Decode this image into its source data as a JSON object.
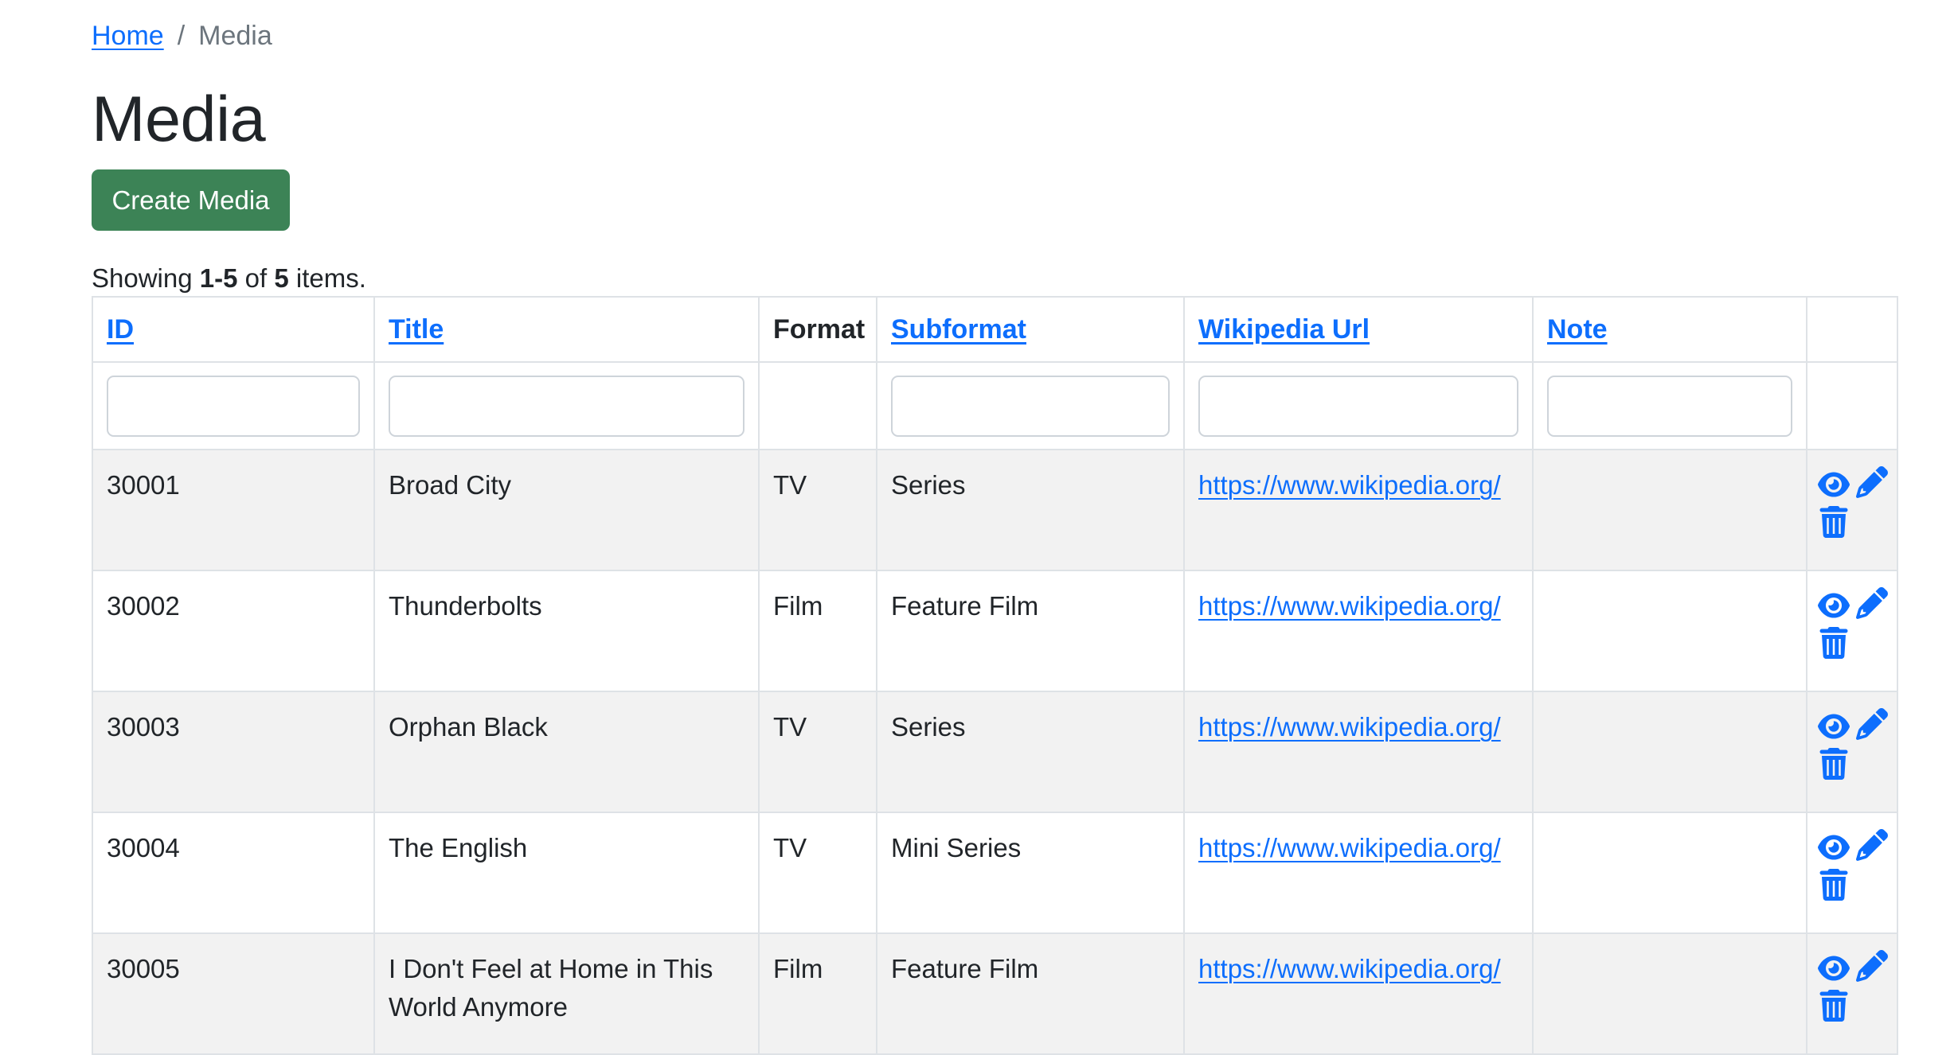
{
  "breadcrumb": {
    "home_label": "Home",
    "separator": "/",
    "current": "Media"
  },
  "page": {
    "title": "Media",
    "create_button_label": "Create Media"
  },
  "summary": {
    "prefix": "Showing",
    "range": "1-5",
    "middle": "of",
    "total": "5",
    "suffix": "items."
  },
  "table": {
    "headers": {
      "id": "ID",
      "title": "Title",
      "format": "Format",
      "subformat": "Subformat",
      "wikipedia_url": "Wikipedia Url",
      "note": "Note"
    },
    "filters": {
      "id": "",
      "title": "",
      "subformat": "",
      "wikipedia_url": "",
      "note": ""
    },
    "rows": [
      {
        "id": "30001",
        "title": "Broad City",
        "format": "TV",
        "subformat": "Series",
        "wikipedia_url": "https://www.wikipedia.org/",
        "note": ""
      },
      {
        "id": "30002",
        "title": "Thunderbolts",
        "format": "Film",
        "subformat": "Feature Film",
        "wikipedia_url": "https://www.wikipedia.org/",
        "note": ""
      },
      {
        "id": "30003",
        "title": "Orphan Black",
        "format": "TV",
        "subformat": "Series",
        "wikipedia_url": "https://www.wikipedia.org/",
        "note": ""
      },
      {
        "id": "30004",
        "title": "The English",
        "format": "TV",
        "subformat": "Mini Series",
        "wikipedia_url": "https://www.wikipedia.org/",
        "note": ""
      },
      {
        "id": "30005",
        "title": "I Don't Feel at Home in This World Anymore",
        "format": "Film",
        "subformat": "Feature Film",
        "wikipedia_url": "https://www.wikipedia.org/",
        "note": ""
      }
    ],
    "action_icons": [
      "eye-icon",
      "pencil-icon",
      "trash-icon"
    ]
  },
  "colors": {
    "link": "#0d6efd",
    "create_button": "#3c8356",
    "striped_row": "#f2f2f2",
    "border": "#dee2e6"
  }
}
